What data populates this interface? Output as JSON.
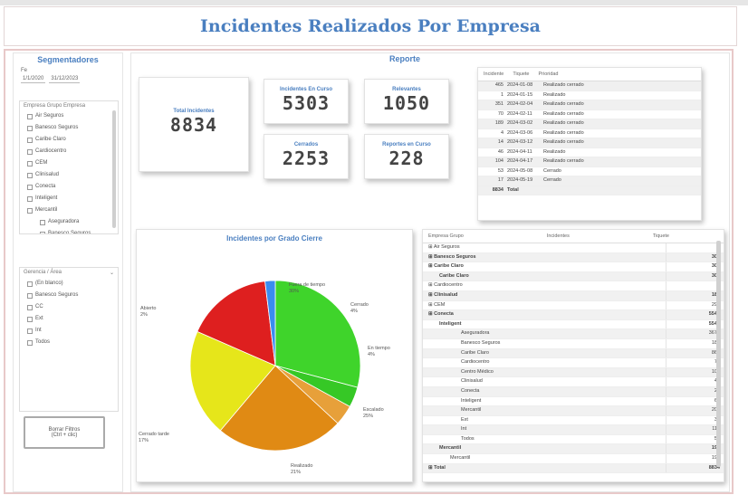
{
  "page": {
    "title": "Incidentes Realizados Por Empresa"
  },
  "filters": {
    "heading": "Segmentadores",
    "date_label": "Fe",
    "date_from": "1/1/2020",
    "date_to": "31/12/2023",
    "company_slicer": {
      "header": "Empresa Grupo Empresa",
      "items": [
        "Air Seguros",
        "Banesco Seguros",
        "Caribe Claro",
        "Cardiocentro",
        "CEM",
        "Clinisalud",
        "Conecta",
        "Inteligent",
        "Mercantil"
      ],
      "sub_items": [
        "Aseguradora",
        "Banesco Seguros",
        "Centro Médico"
      ]
    },
    "area_slicer": {
      "header": "Gerencia / Área",
      "items": [
        "(En blanco)",
        "Banesco Seguros",
        "CC",
        "Ext",
        "Int",
        "Todos"
      ]
    },
    "clear_button": {
      "line1": "Borrar Filtros",
      "line2": "(Ctrl + clic)"
    }
  },
  "report": {
    "heading": "Reporte"
  },
  "cards": {
    "total": {
      "label": "Total Incidentes",
      "value": "8834"
    },
    "card2": {
      "label": "Incidentes En Curso",
      "value": "5303"
    },
    "card3": {
      "label": "Relevantes",
      "value": "1050"
    },
    "card4": {
      "label": "Cerrados",
      "value": "2253"
    },
    "card5": {
      "label": "Reportes en Curso",
      "value": "228"
    }
  },
  "top_table": {
    "headers": [
      "Incidente",
      "Tiquete",
      "Prioridad"
    ],
    "rows": [
      {
        "a": "465",
        "b": "2024-01-08",
        "c": "Realizado cerrado"
      },
      {
        "a": "1",
        "b": "2024-01-15",
        "c": "Realizado"
      },
      {
        "a": "351",
        "b": "2024-02-04",
        "c": "Realizado cerrado"
      },
      {
        "a": "70",
        "b": "2024-02-11",
        "c": "Realizado cerrado"
      },
      {
        "a": "189",
        "b": "2024-03-02",
        "c": "Realizado cerrado"
      },
      {
        "a": "4",
        "b": "2024-03-06",
        "c": "Realizado cerrado"
      },
      {
        "a": "14",
        "b": "2024-03-12",
        "c": "Realizado cerrado"
      },
      {
        "a": "46",
        "b": "2024-04-11",
        "c": "Realizado"
      },
      {
        "a": "104",
        "b": "2024-04-17",
        "c": "Realizado cerrado"
      },
      {
        "a": "53",
        "b": "2024-05-08",
        "c": "Cerrado"
      },
      {
        "a": "17",
        "b": "2024-05-19",
        "c": "Cerrado"
      }
    ],
    "total": {
      "a": "8834",
      "b": "Total"
    }
  },
  "chart_data": {
    "type": "pie",
    "title": "Incidentes por Grado Cierre",
    "slices": [
      {
        "label": "Fuera de tiempo",
        "value": 30.0,
        "color": "#3fd42b"
      },
      {
        "label": "Cerrado",
        "value": 4.0,
        "color": "#36c826"
      },
      {
        "label": "En tiempo",
        "value": 4.0,
        "color": "#e7a03a"
      },
      {
        "label": "Escalado",
        "value": 25.0,
        "color": "#e08a14"
      },
      {
        "label": "Realizado",
        "value": 21.0,
        "color": "#e6e61a"
      },
      {
        "label": "Cerrado tarde",
        "value": 17.0,
        "color": "#de1f1f"
      },
      {
        "label": "Abierto",
        "value": 2.0,
        "color": "#3a8cf0"
      }
    ]
  },
  "matrix": {
    "headers": [
      "Empresa Grupo",
      "Incidentes",
      "Tiquete"
    ],
    "rows": [
      {
        "name": "Air Seguros",
        "v": "1",
        "bold": false,
        "indent": 0
      },
      {
        "name": "Banesco Seguros",
        "v": "305",
        "bold": true,
        "indent": 0
      },
      {
        "name": "Caribe Claro",
        "v": "300",
        "bold": true,
        "indent": 0
      },
      {
        "name": "Caribe Claro",
        "v": "300",
        "bold": true,
        "indent": 2
      },
      {
        "name": "Cardiocentro",
        "v": "3",
        "bold": false,
        "indent": 0
      },
      {
        "name": "Clinisalud",
        "v": "180",
        "bold": true,
        "indent": 0
      },
      {
        "name": "CEM",
        "v": "290",
        "bold": false,
        "indent": 0
      },
      {
        "name": "Conecta",
        "v": "5545",
        "bold": true,
        "indent": 0
      },
      {
        "name": "Inteligent",
        "v": "5545",
        "bold": true,
        "indent": 2
      },
      {
        "name": "Aseguradora",
        "v": "3670",
        "bold": false,
        "indent": 6
      },
      {
        "name": "Banesco Seguros",
        "v": "181",
        "bold": false,
        "indent": 6
      },
      {
        "name": "Caribe Claro",
        "v": "861",
        "bold": false,
        "indent": 6
      },
      {
        "name": "Cardiocentro",
        "v": "73",
        "bold": false,
        "indent": 6
      },
      {
        "name": "Centro Médico",
        "v": "104",
        "bold": false,
        "indent": 6
      },
      {
        "name": "Clinisalud",
        "v": "47",
        "bold": false,
        "indent": 6
      },
      {
        "name": "Conecta",
        "v": "26",
        "bold": false,
        "indent": 6
      },
      {
        "name": "Inteligent",
        "v": "69",
        "bold": false,
        "indent": 6
      },
      {
        "name": "Mercantil",
        "v": "201",
        "bold": false,
        "indent": 6
      },
      {
        "name": "Ext",
        "v": "38",
        "bold": false,
        "indent": 6
      },
      {
        "name": "Int",
        "v": "112",
        "bold": false,
        "indent": 6
      },
      {
        "name": "Todos",
        "v": "59",
        "bold": false,
        "indent": 6
      },
      {
        "name": "Mercantil",
        "v": "195",
        "bold": true,
        "indent": 2
      },
      {
        "name": "Mercantil",
        "v": "195",
        "bold": false,
        "indent": 4
      },
      {
        "name": "Total",
        "v": "8834",
        "bold": true,
        "indent": 0
      }
    ]
  }
}
